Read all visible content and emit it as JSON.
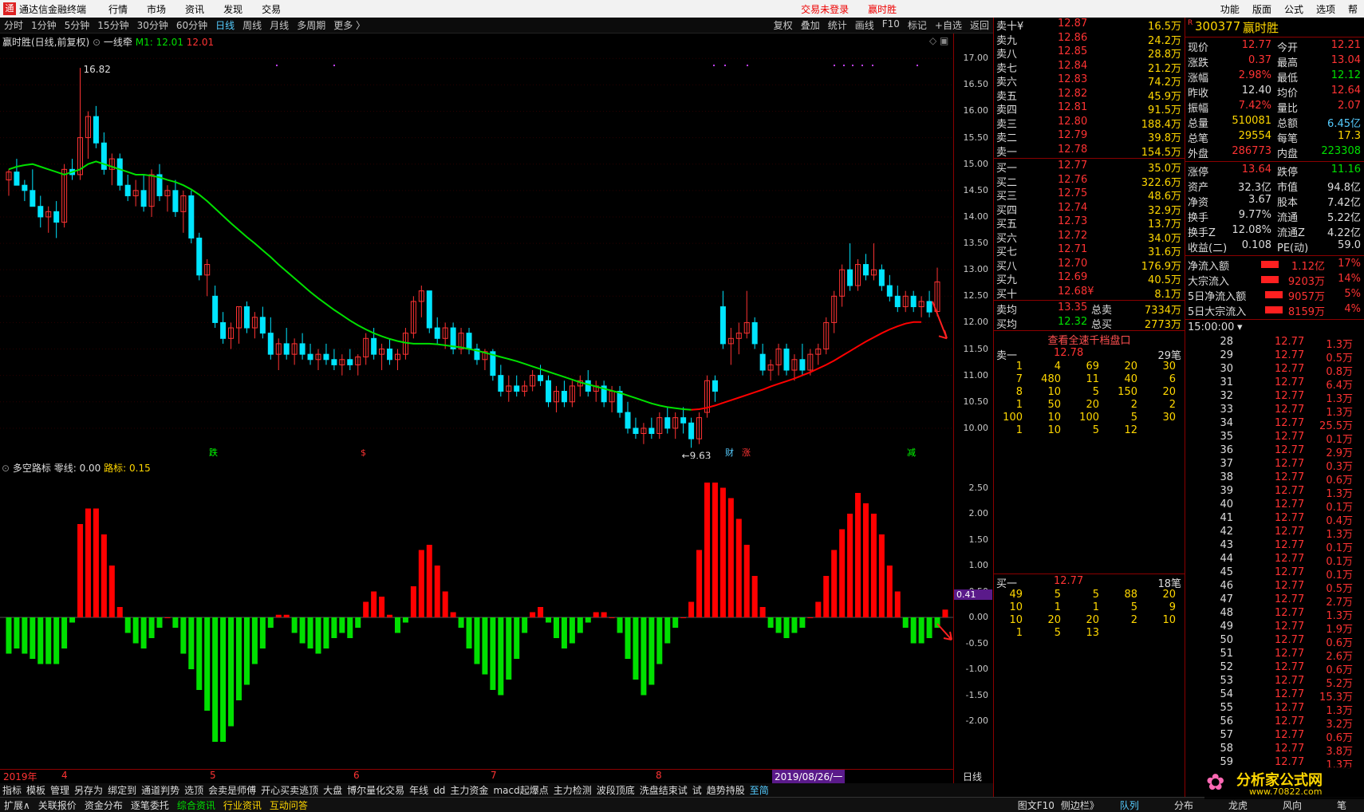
{
  "app": {
    "title": "通达信金融终端",
    "login": "交易未登录",
    "stock_tag": "赢时胜"
  },
  "menu": [
    "行情",
    "市场",
    "资讯",
    "发现",
    "交易"
  ],
  "menu_right": [
    "功能",
    "版面",
    "公式",
    "选项",
    "帮"
  ],
  "periods": [
    "分时",
    "1分钟",
    "5分钟",
    "15分钟",
    "30分钟",
    "60分钟",
    "日线",
    "周线",
    "月线",
    "多周期",
    "更多 〉"
  ],
  "active_period": "日线",
  "tools": [
    "复权",
    "叠加",
    "统计",
    "画线",
    "F10",
    "标记",
    "+自选",
    "返回"
  ],
  "chart_head": {
    "name": "赢时胜(日线,前复权)",
    "indicator": "一线牵",
    "m1": "M1: 12.01",
    "m1b": "12.01"
  },
  "sub_head": {
    "name": "多空路标",
    "zero": "零线: 0.00",
    "lubiao": "路标: 0.15"
  },
  "labels": {
    "hi": "16.82",
    "lo": "←9.63",
    "subcur": "0.41",
    "date_tag": "2019/08/26/一",
    "period_label": "日线",
    "cai": "财",
    "zhang": "涨",
    "die": "跌",
    "s": "$",
    "jian": "减"
  },
  "price_axis": [
    "17.00",
    "16.50",
    "16.00",
    "15.50",
    "15.00",
    "14.50",
    "14.00",
    "13.50",
    "13.00",
    "12.50",
    "12.00",
    "11.50",
    "11.00",
    "10.50",
    "10.00"
  ],
  "sub_axis": [
    "2.50",
    "2.00",
    "1.50",
    "1.00",
    "0.50",
    "0.00",
    "-0.50",
    "-1.00",
    "-1.50",
    "-2.00"
  ],
  "dates": [
    {
      "t": "2019年",
      "x": 4
    },
    {
      "t": "4",
      "x": 77
    },
    {
      "t": "5",
      "x": 263
    },
    {
      "t": "6",
      "x": 443
    },
    {
      "t": "7",
      "x": 615
    },
    {
      "t": "8",
      "x": 822
    }
  ],
  "funcs": [
    "指标",
    "模板",
    "管理",
    "另存为",
    "绑定到",
    "通道判势",
    "选顶",
    "会卖是师傅",
    "开心买卖逃顶",
    "大盘",
    "博尔量化交易",
    "年线",
    "dd",
    "主力资金",
    "macd起爆点",
    "主力检测",
    "波段顶底",
    "洗盘结束试",
    "试",
    "趋势持股",
    "至简"
  ],
  "bottom": [
    "扩展∧",
    "关联报价",
    "资金分布",
    "逐笔委托",
    "综合资讯",
    "行业资讯",
    "互动问答"
  ],
  "bottom_right": [
    "图文F10",
    "侧边栏》",
    "队列",
    "分布",
    "龙虎",
    "风向",
    "笔"
  ],
  "sell": [
    [
      "卖十¥",
      "12.87",
      "16.5万"
    ],
    [
      "卖九",
      "12.86",
      "24.2万"
    ],
    [
      "卖八",
      "12.85",
      "28.8万"
    ],
    [
      "卖七",
      "12.84",
      "21.2万"
    ],
    [
      "卖六",
      "12.83",
      "74.2万"
    ],
    [
      "卖五",
      "12.82",
      "45.9万"
    ],
    [
      "卖四",
      "12.81",
      "91.5万"
    ],
    [
      "卖三",
      "12.80",
      "188.4万"
    ],
    [
      "卖二",
      "12.79",
      "39.8万"
    ],
    [
      "卖一",
      "12.78",
      "154.5万"
    ]
  ],
  "buy": [
    [
      "买一",
      "12.77",
      "35.0万"
    ],
    [
      "买二",
      "12.76",
      "322.6万"
    ],
    [
      "买三",
      "12.75",
      "48.6万"
    ],
    [
      "买四",
      "12.74",
      "32.9万"
    ],
    [
      "买五",
      "12.73",
      "13.7万"
    ],
    [
      "买六",
      "12.72",
      "34.0万"
    ],
    [
      "买七",
      "12.71",
      "31.6万"
    ],
    [
      "买八",
      "12.70",
      "176.9万"
    ],
    [
      "买九",
      "12.69",
      "40.5万"
    ],
    [
      "买十",
      "12.68¥",
      "8.1万"
    ]
  ],
  "avg": [
    [
      "卖均",
      "13.35",
      "总卖",
      "7334万"
    ],
    [
      "买均",
      "12.32",
      "总买",
      "2773万"
    ]
  ],
  "link": "查看全速千档盘口",
  "q1": {
    "label": "卖一",
    "price": "12.78",
    "cnt": "29笔",
    "rows": [
      [
        "1",
        "4",
        "69",
        "20",
        "30"
      ],
      [
        "7",
        "480",
        "11",
        "40",
        "6"
      ],
      [
        "8",
        "10",
        "5",
        "150",
        "20"
      ],
      [
        "1",
        "50",
        "20",
        "2",
        "2"
      ],
      [
        "100",
        "10",
        "100",
        "5",
        "30"
      ],
      [
        "1",
        "10",
        "5",
        "12",
        ""
      ]
    ]
  },
  "q2": {
    "label": "买一",
    "price": "12.77",
    "cnt": "18笔",
    "rows": [
      [
        "49",
        "5",
        "5",
        "88",
        "20"
      ],
      [
        "10",
        "1",
        "1",
        "5",
        "9"
      ],
      [
        "10",
        "20",
        "20",
        "2",
        "10"
      ],
      [
        "1",
        "5",
        "13",
        "",
        ""
      ]
    ]
  },
  "stock": {
    "code": "300377",
    "name": "赢时胜",
    "flag": "R"
  },
  "info": [
    [
      "现价",
      "12.77",
      "今开",
      "12.21"
    ],
    [
      "涨跌",
      "0.37",
      "最高",
      "13.04"
    ],
    [
      "涨幅",
      "2.98%",
      "最低",
      "12.12"
    ],
    [
      "昨收",
      "12.40",
      "均价",
      "12.64"
    ],
    [
      "振幅",
      "7.42%",
      "量比",
      "2.07"
    ],
    [
      "总量",
      "510081",
      "总额",
      "6.45亿"
    ],
    [
      "总笔",
      "29554",
      "每笔",
      "17.3"
    ],
    [
      "外盘",
      "286773",
      "内盘",
      "223308"
    ]
  ],
  "info2": [
    [
      "涨停",
      "13.64",
      "跌停",
      "11.16"
    ],
    [
      "资产",
      "32.3亿",
      "市值",
      "94.8亿"
    ],
    [
      "净资",
      "3.67",
      "股本",
      "7.42亿"
    ],
    [
      "换手",
      "9.77%",
      "流通",
      "5.22亿"
    ],
    [
      "换手Z",
      "12.08%",
      "流通Z",
      "4.22亿"
    ],
    [
      "收益(二)",
      "0.108",
      "PE(动)",
      "59.0"
    ]
  ],
  "flow": [
    [
      "净流入额",
      "1.12亿",
      "17%"
    ],
    [
      "大宗流入",
      "9203万",
      "14%"
    ],
    [
      "5日净流入额",
      "9057万",
      "5%"
    ],
    [
      "5日大宗流入",
      "8159万",
      "4%"
    ]
  ],
  "ticks_head": "15:00:00",
  "ticks": [
    [
      "28",
      "12.77",
      "1.3万"
    ],
    [
      "29",
      "12.77",
      "0.5万"
    ],
    [
      "30",
      "12.77",
      "0.8万"
    ],
    [
      "31",
      "12.77",
      "6.4万"
    ],
    [
      "32",
      "12.77",
      "1.3万"
    ],
    [
      "33",
      "12.77",
      "1.3万"
    ],
    [
      "34",
      "12.77",
      "25.5万"
    ],
    [
      "35",
      "12.77",
      "0.1万"
    ],
    [
      "36",
      "12.77",
      "2.9万"
    ],
    [
      "37",
      "12.77",
      "0.3万"
    ],
    [
      "38",
      "12.77",
      "0.6万"
    ],
    [
      "39",
      "12.77",
      "1.3万"
    ],
    [
      "40",
      "12.77",
      "0.1万"
    ],
    [
      "41",
      "12.77",
      "0.4万"
    ],
    [
      "42",
      "12.77",
      "1.3万"
    ],
    [
      "43",
      "12.77",
      "0.1万"
    ],
    [
      "44",
      "12.77",
      "0.1万"
    ],
    [
      "45",
      "12.77",
      "0.1万"
    ],
    [
      "46",
      "12.77",
      "0.5万"
    ],
    [
      "47",
      "12.77",
      "2.7万"
    ],
    [
      "48",
      "12.77",
      "1.3万"
    ],
    [
      "49",
      "12.77",
      "1.9万"
    ],
    [
      "50",
      "12.77",
      "0.6万"
    ],
    [
      "51",
      "12.77",
      "2.6万"
    ],
    [
      "52",
      "12.77",
      "0.6万"
    ],
    [
      "53",
      "12.77",
      "5.2万"
    ],
    [
      "54",
      "12.77",
      "15.3万"
    ],
    [
      "55",
      "12.77",
      "1.3万"
    ],
    [
      "56",
      "12.77",
      "3.2万"
    ],
    [
      "57",
      "12.77",
      "0.6万"
    ],
    [
      "58",
      "12.77",
      "3.8万"
    ],
    [
      "59",
      "12.77",
      "1.3万"
    ]
  ],
  "watermark": {
    "t1": "分析家公式网",
    "t2": "www.70822.com"
  },
  "colors": {
    "up": "#ff3333",
    "down": "#00e5ff",
    "ma": "#00e000",
    "ma2": "#ff0000",
    "sub_pos": "#ff0000",
    "sub_neg": "#00e000"
  },
  "chart_data": {
    "type": "candlestick",
    "ylim": [
      9.5,
      17.2
    ],
    "candles": [
      [
        14.7,
        14.9,
        14.4,
        14.85
      ],
      [
        14.85,
        15.1,
        14.7,
        14.6
      ],
      [
        14.6,
        14.7,
        14.3,
        14.5
      ],
      [
        14.5,
        14.9,
        14.3,
        14.2
      ],
      [
        14.2,
        14.4,
        13.8,
        14.0
      ],
      [
        14.0,
        14.2,
        13.7,
        14.1
      ],
      [
        14.1,
        14.3,
        13.6,
        13.9
      ],
      [
        13.9,
        15.0,
        13.8,
        14.9
      ],
      [
        14.9,
        15.1,
        14.7,
        14.8
      ],
      [
        14.8,
        16.82,
        14.7,
        15.5
      ],
      [
        15.5,
        16.0,
        15.1,
        15.9
      ],
      [
        15.9,
        16.1,
        15.3,
        15.4
      ],
      [
        15.4,
        15.6,
        14.8,
        14.9
      ],
      [
        14.9,
        15.2,
        14.6,
        15.1
      ],
      [
        15.1,
        15.2,
        14.5,
        14.6
      ],
      [
        14.6,
        14.8,
        14.3,
        14.4
      ],
      [
        14.4,
        14.7,
        14.2,
        14.5
      ],
      [
        14.5,
        14.8,
        14.1,
        14.2
      ],
      [
        14.2,
        14.9,
        14.0,
        14.8
      ],
      [
        14.8,
        15.0,
        14.3,
        14.4
      ],
      [
        14.4,
        14.6,
        14.1,
        14.5
      ],
      [
        14.5,
        14.7,
        14.0,
        14.1
      ],
      [
        14.1,
        14.5,
        13.7,
        14.4
      ],
      [
        14.4,
        14.5,
        13.5,
        13.6
      ],
      [
        13.6,
        13.7,
        12.8,
        12.9
      ],
      [
        12.9,
        13.2,
        12.5,
        13.1
      ],
      [
        12.5,
        12.7,
        11.9,
        12.0
      ],
      [
        12.0,
        12.2,
        11.6,
        11.7
      ],
      [
        11.7,
        12.0,
        11.5,
        11.9
      ],
      [
        11.9,
        12.3,
        11.6,
        12.3
      ],
      [
        12.3,
        12.4,
        11.8,
        11.9
      ],
      [
        11.9,
        12.2,
        11.7,
        12.1
      ],
      [
        12.1,
        12.3,
        11.7,
        11.8
      ],
      [
        11.8,
        12.1,
        11.3,
        11.4
      ],
      [
        11.4,
        11.7,
        11.1,
        11.6
      ],
      [
        11.6,
        11.9,
        11.3,
        11.4
      ],
      [
        11.4,
        11.7,
        11.2,
        11.6
      ],
      [
        11.6,
        11.8,
        11.3,
        11.4
      ],
      [
        11.4,
        11.6,
        11.2,
        11.3
      ],
      [
        11.3,
        11.5,
        11.1,
        11.4
      ],
      [
        11.4,
        11.6,
        11.2,
        11.3
      ],
      [
        11.3,
        11.5,
        11.1,
        11.2
      ],
      [
        11.2,
        11.4,
        11.0,
        11.3
      ],
      [
        11.3,
        11.5,
        11.1,
        11.2
      ],
      [
        11.2,
        11.4,
        11.0,
        11.35
      ],
      [
        11.35,
        11.8,
        11.2,
        11.7
      ],
      [
        11.7,
        11.9,
        11.3,
        11.4
      ],
      [
        11.4,
        11.6,
        11.1,
        11.5
      ],
      [
        11.5,
        11.7,
        11.2,
        11.3
      ],
      [
        11.3,
        11.5,
        11.1,
        11.4
      ],
      [
        11.4,
        11.9,
        11.3,
        11.8
      ],
      [
        11.8,
        12.5,
        11.7,
        12.4
      ],
      [
        12.4,
        12.7,
        12.1,
        12.6
      ],
      [
        12.6,
        12.6,
        11.8,
        11.9
      ],
      [
        11.9,
        12.1,
        11.6,
        11.7
      ],
      [
        11.7,
        12.0,
        11.5,
        11.9
      ],
      [
        11.9,
        12.0,
        11.4,
        11.5
      ],
      [
        11.5,
        11.9,
        11.4,
        11.8
      ],
      [
        11.8,
        11.9,
        11.4,
        11.5
      ],
      [
        11.5,
        11.6,
        11.2,
        11.3
      ],
      [
        11.3,
        11.5,
        11.1,
        11.45
      ],
      [
        11.45,
        11.5,
        10.9,
        11.0
      ],
      [
        11.0,
        11.2,
        10.6,
        10.7
      ],
      [
        10.7,
        11.0,
        10.5,
        10.8
      ],
      [
        10.8,
        11.0,
        10.6,
        10.7
      ],
      [
        10.7,
        10.9,
        10.6,
        10.8
      ],
      [
        10.8,
        11.1,
        10.7,
        11.0
      ],
      [
        11.0,
        11.2,
        10.8,
        10.9
      ],
      [
        10.9,
        11.0,
        10.4,
        10.5
      ],
      [
        10.5,
        10.8,
        10.3,
        10.7
      ],
      [
        10.7,
        10.9,
        10.4,
        10.5
      ],
      [
        10.5,
        10.9,
        10.4,
        10.8
      ],
      [
        10.8,
        11.0,
        10.6,
        10.9
      ],
      [
        10.9,
        11.1,
        10.6,
        10.7
      ],
      [
        10.7,
        10.9,
        10.5,
        10.8
      ],
      [
        10.8,
        10.9,
        10.4,
        10.5
      ],
      [
        10.5,
        10.8,
        10.3,
        10.7
      ],
      [
        10.7,
        10.8,
        10.2,
        10.3
      ],
      [
        10.3,
        10.5,
        9.9,
        10.0
      ],
      [
        10.0,
        10.2,
        9.8,
        9.9
      ],
      [
        9.9,
        10.1,
        9.7,
        10.0
      ],
      [
        10.0,
        10.2,
        9.8,
        9.9
      ],
      [
        9.9,
        10.3,
        9.8,
        10.2
      ],
      [
        10.2,
        10.4,
        9.9,
        10.0
      ],
      [
        10.0,
        10.3,
        9.8,
        10.2
      ],
      [
        10.2,
        10.4,
        9.9,
        10.1
      ],
      [
        10.1,
        10.2,
        9.63,
        9.8
      ],
      [
        9.8,
        10.3,
        9.7,
        10.2
      ],
      [
        10.3,
        11.0,
        10.2,
        10.9
      ],
      [
        10.9,
        11.0,
        10.5,
        10.7
      ],
      [
        12.3,
        12.6,
        11.5,
        11.6
      ],
      [
        11.6,
        11.9,
        11.2,
        11.7
      ],
      [
        11.7,
        12.0,
        11.4,
        11.8
      ],
      [
        11.8,
        12.6,
        11.7,
        12.0
      ],
      [
        12.0,
        12.1,
        11.5,
        11.6
      ],
      [
        11.4,
        11.6,
        11.0,
        11.1
      ],
      [
        11.1,
        11.3,
        10.9,
        11.2
      ],
      [
        11.2,
        11.6,
        11.0,
        11.5
      ],
      [
        11.5,
        11.6,
        11.0,
        11.1
      ],
      [
        11.1,
        11.4,
        10.9,
        11.3
      ],
      [
        11.3,
        11.6,
        11.0,
        11.1
      ],
      [
        11.1,
        11.5,
        11.0,
        11.4
      ],
      [
        11.4,
        11.6,
        11.2,
        11.5
      ],
      [
        11.5,
        12.1,
        11.4,
        12.0
      ],
      [
        12.0,
        12.6,
        11.8,
        12.5
      ],
      [
        12.5,
        13.1,
        12.3,
        13.0
      ],
      [
        13.0,
        13.5,
        12.6,
        12.7
      ],
      [
        12.7,
        13.2,
        12.6,
        13.1
      ],
      [
        13.1,
        13.3,
        12.8,
        12.9
      ],
      [
        12.9,
        13.5,
        12.8,
        13.0
      ],
      [
        13.0,
        13.1,
        12.6,
        12.7
      ],
      [
        12.7,
        12.9,
        12.4,
        12.5
      ],
      [
        12.5,
        12.7,
        12.2,
        12.3
      ],
      [
        12.3,
        12.6,
        12.2,
        12.5
      ],
      [
        12.5,
        12.6,
        12.2,
        12.3
      ],
      [
        12.3,
        12.5,
        12.1,
        12.4
      ],
      [
        12.4,
        12.6,
        12.1,
        12.2
      ],
      [
        12.21,
        13.04,
        12.12,
        12.77
      ]
    ],
    "ma": [
      14.9,
      14.95,
      14.98,
      15.0,
      14.95,
      14.9,
      14.85,
      14.8,
      14.85,
      14.9,
      15.0,
      15.05,
      15.0,
      14.95,
      14.9,
      14.85,
      14.8,
      14.8,
      14.78,
      14.75,
      14.7,
      14.66,
      14.6,
      14.52,
      14.42,
      14.3,
      14.16,
      14.02,
      13.88,
      13.75,
      13.62,
      13.5,
      13.37,
      13.24,
      13.1,
      12.97,
      12.84,
      12.71,
      12.58,
      12.46,
      12.35,
      12.24,
      12.14,
      12.04,
      11.95,
      11.87,
      11.8,
      11.74,
      11.69,
      11.65,
      11.62,
      11.6,
      11.6,
      11.6,
      11.59,
      11.57,
      11.55,
      11.53,
      11.5,
      11.47,
      11.43,
      11.39,
      11.35,
      11.31,
      11.27,
      11.22,
      11.17,
      11.12,
      11.07,
      11.02,
      10.97,
      10.92,
      10.87,
      10.83,
      10.79,
      10.75,
      10.71,
      10.67,
      10.62,
      10.57,
      10.52,
      10.47,
      10.43,
      10.4,
      10.38,
      10.36,
      10.35,
      10.36,
      10.39,
      10.43,
      10.48,
      10.53,
      10.58,
      10.63,
      10.68,
      10.73,
      10.79,
      10.84,
      10.89,
      10.94,
      11.0,
      11.06,
      11.13,
      11.2,
      11.28,
      11.37,
      11.46,
      11.55,
      11.64,
      11.72,
      11.8,
      11.87,
      11.93,
      11.98,
      12.01,
      12.01
    ],
    "sub": [
      -0.7,
      -0.6,
      -0.7,
      -0.8,
      -0.9,
      -0.9,
      -0.9,
      -0.6,
      -0.1,
      1.8,
      2.1,
      2.1,
      1.6,
      1.0,
      0.2,
      -0.3,
      -0.5,
      -0.6,
      -0.4,
      -0.2,
      0.0,
      -0.2,
      -0.7,
      -1.0,
      -1.4,
      -1.8,
      -2.4,
      -2.4,
      -2.1,
      -1.6,
      -1.3,
      -0.9,
      -0.6,
      -0.2,
      0.05,
      0.05,
      -0.3,
      -0.5,
      -0.6,
      -0.7,
      -0.6,
      -0.4,
      -0.3,
      -0.4,
      -0.2,
      0.3,
      0.5,
      0.4,
      0.05,
      -0.3,
      -0.1,
      0.6,
      1.3,
      1.4,
      1.0,
      0.5,
      0.1,
      -0.2,
      -0.6,
      -0.9,
      -1.1,
      -1.4,
      -1.5,
      -1.2,
      -0.8,
      -0.3,
      0.1,
      0.2,
      -0.1,
      -0.4,
      -0.6,
      -0.5,
      -0.3,
      -0.1,
      0.1,
      0.1,
      0.0,
      -0.3,
      -0.8,
      -1.2,
      -1.5,
      -1.3,
      -0.9,
      -0.5,
      -0.2,
      0.0,
      0.3,
      1.3,
      2.6,
      2.6,
      2.5,
      2.3,
      1.9,
      1.4,
      0.8,
      0.2,
      -0.2,
      -0.3,
      -0.4,
      -0.3,
      -0.2,
      0.0,
      0.3,
      0.8,
      1.3,
      1.7,
      2.0,
      2.4,
      2.2,
      2.0,
      1.6,
      1.0,
      0.5,
      -0.2,
      -0.5,
      -0.5,
      -0.4,
      -0.2,
      0.15
    ]
  }
}
